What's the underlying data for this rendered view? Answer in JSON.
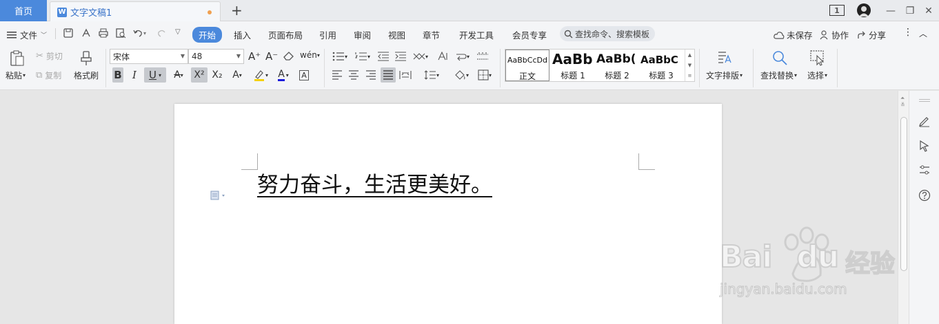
{
  "tabbar": {
    "home_tab": "首页",
    "doc_tab_title": "文字文稿1",
    "doc_logo": "W",
    "add_tab": "+",
    "page_badge": "1",
    "window_controls": [
      "—",
      "❐",
      "✕"
    ]
  },
  "menubar": {
    "file_label": "文件",
    "tabs": [
      "开始",
      "插入",
      "页面布局",
      "引用",
      "审阅",
      "视图",
      "章节",
      "开发工具",
      "会员专享"
    ],
    "search_placeholder": "查找命令、搜索模板",
    "unsaved": "未保存",
    "collaborate": "协作",
    "share": "分享"
  },
  "ribbon": {
    "paste": "粘贴",
    "cut": "剪切",
    "copy": "复制",
    "format_painter": "格式刷",
    "font_name": "宋体",
    "font_size": "48",
    "styles": [
      {
        "sample": "AaBbCcDd",
        "label": "正文"
      },
      {
        "sample": "AaBb",
        "label": "标题 1"
      },
      {
        "sample": "AaBb(",
        "label": "标题 2"
      },
      {
        "sample": "AaBbC",
        "label": "标题 3"
      }
    ],
    "text_layout": "文字排版",
    "find_replace": "查找替换",
    "select": "选择"
  },
  "document": {
    "body_text": "努力奋斗，生活更美好。"
  },
  "watermark": {
    "brand": "Bai",
    "brand2": "du",
    "suffix": "经验",
    "url": "jingyan.baidu.com"
  },
  "colors": {
    "accent": "#4b89dc",
    "font_color_underline": "#1a1adc",
    "highlight": "#f5d100"
  }
}
